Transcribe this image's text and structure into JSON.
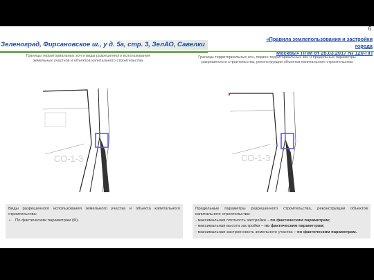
{
  "page_number": "6",
  "main_title": "Зеленоград, Фирсановское ш., у д. 5а, стр. 3, ЗелАО, Савелки",
  "rules_title": {
    "line1": "«Правила землепользования и застройки",
    "line2": "города",
    "line3": "Москвы» ППМ от 28.03.2017 № 120-ПП"
  },
  "left_caption": "Границы территориальных зон и виды разрешенного использования земельных участков и объектов капитального строительства",
  "right_caption": "Границы территориальных зон, подзон территориальных зон и предельные параметры разрешенного строительства, реконструкции объектов капитального строительства",
  "map_labels": {
    "left_zone": "СО-1-3",
    "right_zone": "СО-1-3"
  },
  "left_panel": {
    "text": "Виды разрешенного использования земельного участка и объекта капитального строительства:",
    "bullet": "По фактическим параметрам (Ф)."
  },
  "right_panel": {
    "intro": "Предельные параметры разрешенного строительства, реконструкции объектов капитального строительства:",
    "items": [
      {
        "label": "- максимальная плотность застройки – ",
        "value": "по фактическим параметрам;"
      },
      {
        "label": "- максимальная высота застройки – ",
        "value": "по фактическим параметрам;"
      },
      {
        "label": "- максимальная застроенность земельного участка – ",
        "value": "по фактическим параметрам."
      }
    ]
  },
  "colors": {
    "title_blue": "#1f4aa8",
    "accent_green": "#6aa84f",
    "parcel_blue": "#5a5ad8"
  }
}
